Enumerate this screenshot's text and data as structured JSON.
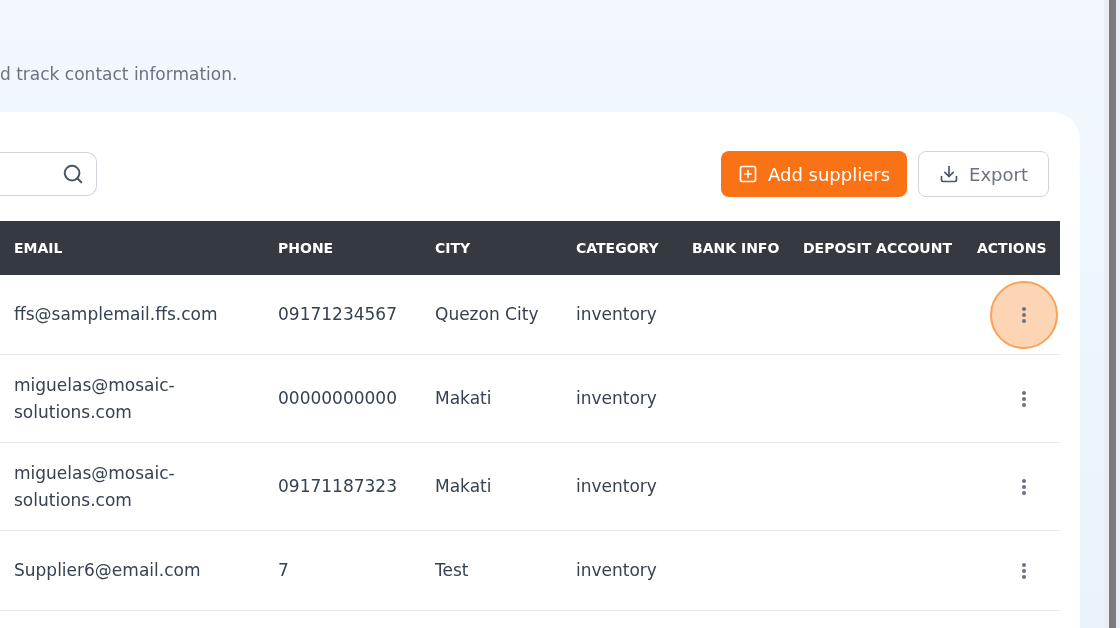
{
  "subtitle": "d track contact information.",
  "buttons": {
    "add": "Add suppliers",
    "export": "Export"
  },
  "table": {
    "columns": [
      "EMAIL",
      "PHONE",
      "CITY",
      "CATEGORY",
      "BANK INFO",
      "DEPOSIT ACCOUNT",
      "ACTIONS"
    ],
    "rows": [
      {
        "email": "ffs@samplemail.ffs.com",
        "phone": "09171234567",
        "city": "Quezon City",
        "category": "inventory",
        "highlighted": true
      },
      {
        "email": "miguelas@mosaic-solutions.com",
        "phone": "00000000000",
        "city": "Makati",
        "category": "inventory",
        "highlighted": false
      },
      {
        "email": "miguelas@mosaic-solutions.com",
        "phone": "09171187323",
        "city": "Makati",
        "category": "inventory",
        "highlighted": false
      },
      {
        "email": "Supplier6@email.com",
        "phone": "7",
        "city": "Test",
        "category": "inventory",
        "highlighted": false
      }
    ]
  }
}
